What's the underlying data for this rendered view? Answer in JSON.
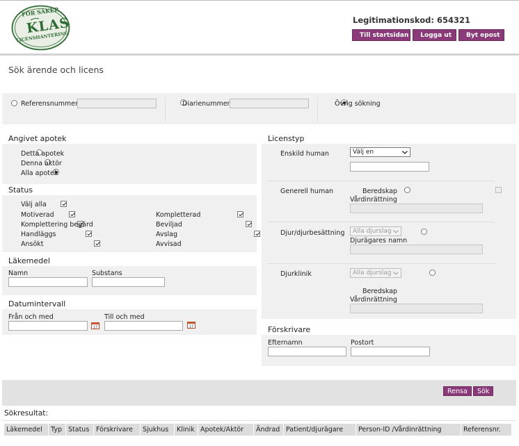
{
  "logo": {
    "top_text": "FÖR SÄKER",
    "main_text": "KLAS",
    "bottom_text": "LICENSHANTERING"
  },
  "header": {
    "legit_label": "Legitimationskod:",
    "legit_code": "654321",
    "buttons": [
      {
        "label": "Till startsidan",
        "icon": "home-icon"
      },
      {
        "label": "Logga ut",
        "icon": "logout-icon"
      },
      {
        "label": "Byt epost",
        "icon": "mail-icon"
      }
    ]
  },
  "page_title": "Sök ärende och licens",
  "search_type": {
    "options": [
      "Referensnummer",
      "Diarienummer",
      "Övrig sökning"
    ],
    "selected": "Övrig sökning"
  },
  "apotek": {
    "title": "Angivet apotek",
    "options": [
      "Detta apotek",
      "Denna aktör",
      "Alla apotek"
    ],
    "selected": "Alla apotek"
  },
  "status": {
    "title": "Status",
    "select_all": "Välj alla",
    "left": [
      "Motiverad",
      "Komplettering begärd",
      "Handläggs",
      "Ansökt"
    ],
    "right": [
      "Kompletterad",
      "Beviljad",
      "Avslag",
      "Avvisad"
    ]
  },
  "lakemedel": {
    "title": "Läkemedel",
    "namn": "Namn",
    "substans": "Substans"
  },
  "datum": {
    "title": "Datumintervall",
    "from": "Från och med",
    "to": "Till och med"
  },
  "licenstyp": {
    "title": "Licenstyp",
    "enskild": "Enskild human",
    "enskild_select": "Välj en",
    "generell": "Generell human",
    "beredskap": "Beredskap",
    "vardinrattning": "Vårdinrättning",
    "djur": "Djur/djurbesättning",
    "djurslag": "Alla djurslag",
    "djuragares_namn": "Djurägares namn",
    "djurklinik": "Djurklinik"
  },
  "forskrivare": {
    "title": "Förskrivare",
    "efternamn": "Efternamn",
    "postort": "Postort"
  },
  "actions": {
    "rensa": "Rensa",
    "sok": "Sök"
  },
  "results": {
    "title": "Sökresultat:",
    "columns": [
      "Läkemedel",
      "Typ",
      "Status",
      "Förskrivare",
      "Sjukhus",
      "Klinik",
      "Apotek/Aktör",
      "Ändrad",
      "Patient/djurägare",
      "Person-ID /Vårdinrättning",
      "Referensnr."
    ]
  },
  "colors": {
    "accent": "#8a3a78",
    "logo_green": "#2e6b34",
    "panel": "#f0f0f0"
  }
}
